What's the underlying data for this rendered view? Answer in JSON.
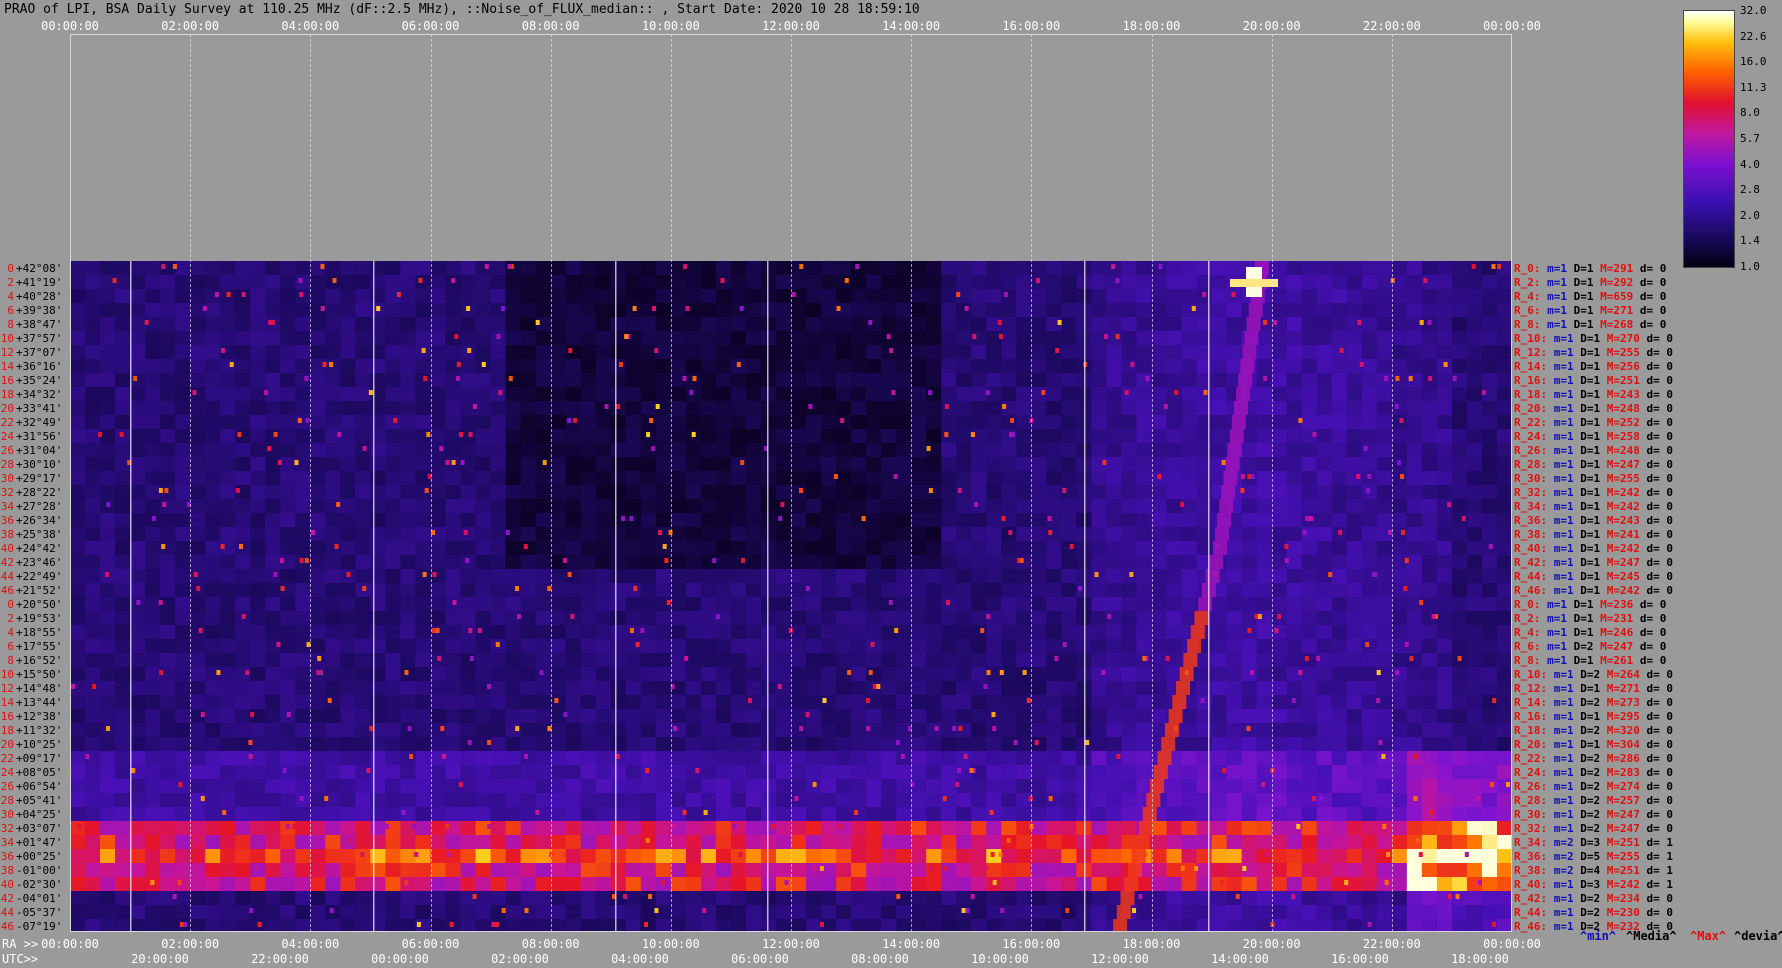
{
  "title": "PRAO of LPI, BSA Daily Survey at 110.25 MHz (dF::2.5 MHz), ::Noise_of_FLUX_median:: , Start Date: 2020 10 28 18:59:10",
  "top_axis_labels": [
    "00:00:00",
    "02:00:00",
    "04:00:00",
    "06:00:00",
    "08:00:00",
    "10:00:00",
    "12:00:00",
    "14:00:00",
    "16:00:00",
    "18:00:00",
    "20:00:00",
    "22:00:00",
    "00:00:00"
  ],
  "ra_axis": {
    "prefix": "RA >>",
    "labels": [
      "00:00:00",
      "02:00:00",
      "04:00:00",
      "06:00:00",
      "08:00:00",
      "10:00:00",
      "12:00:00",
      "14:00:00",
      "16:00:00",
      "18:00:00",
      "20:00:00",
      "22:00:00",
      "00:00:00"
    ]
  },
  "utc_axis": {
    "prefix": "UTC>>",
    "labels": [
      "20:00:00",
      "22:00:00",
      "00:00:00",
      "02:00:00",
      "04:00:00",
      "06:00:00",
      "08:00:00",
      "10:00:00",
      "12:00:00",
      "14:00:00",
      "16:00:00",
      "18:00:00"
    ]
  },
  "colorbar": {
    "ticks": [
      "32.0",
      "22.6",
      "16.0",
      "11.3",
      "8.0",
      "5.7",
      "4.0",
      "2.8",
      "2.0",
      "1.4",
      "1.0"
    ]
  },
  "beam_rows": [
    {
      "idx": "0",
      "dec": "+42°08'",
      "r": "R_0:",
      "m": "m=1",
      "d": "D=1",
      "mx": "M=291",
      "dd": "d= 0"
    },
    {
      "idx": "2",
      "dec": "+41°19'",
      "r": "R_2:",
      "m": "m=1",
      "d": "D=1",
      "mx": "M=292",
      "dd": "d= 0"
    },
    {
      "idx": "4",
      "dec": "+40°28'",
      "r": "R_4:",
      "m": "m=1",
      "d": "D=1",
      "mx": "M=659",
      "dd": "d= 0"
    },
    {
      "idx": "6",
      "dec": "+39°38'",
      "r": "R_6:",
      "m": "m=1",
      "d": "D=1",
      "mx": "M=271",
      "dd": "d= 0"
    },
    {
      "idx": "8",
      "dec": "+38°47'",
      "r": "R_8:",
      "m": "m=1",
      "d": "D=1",
      "mx": "M=268",
      "dd": "d= 0"
    },
    {
      "idx": "10",
      "dec": "+37°57'",
      "r": "R_10:",
      "m": "m=1",
      "d": "D=1",
      "mx": "M=270",
      "dd": "d= 0"
    },
    {
      "idx": "12",
      "dec": "+37°07'",
      "r": "R_12:",
      "m": "m=1",
      "d": "D=1",
      "mx": "M=255",
      "dd": "d= 0"
    },
    {
      "idx": "14",
      "dec": "+36°16'",
      "r": "R_14:",
      "m": "m=1",
      "d": "D=1",
      "mx": "M=256",
      "dd": "d= 0"
    },
    {
      "idx": "16",
      "dec": "+35°24'",
      "r": "R_16:",
      "m": "m=1",
      "d": "D=1",
      "mx": "M=251",
      "dd": "d= 0"
    },
    {
      "idx": "18",
      "dec": "+34°32'",
      "r": "R_18:",
      "m": "m=1",
      "d": "D=1",
      "mx": "M=243",
      "dd": "d= 0"
    },
    {
      "idx": "20",
      "dec": "+33°41'",
      "r": "R_20:",
      "m": "m=1",
      "d": "D=1",
      "mx": "M=248",
      "dd": "d= 0"
    },
    {
      "idx": "22",
      "dec": "+32°49'",
      "r": "R_22:",
      "m": "m=1",
      "d": "D=1",
      "mx": "M=252",
      "dd": "d= 0"
    },
    {
      "idx": "24",
      "dec": "+31°56'",
      "r": "R_24:",
      "m": "m=1",
      "d": "D=1",
      "mx": "M=258",
      "dd": "d= 0"
    },
    {
      "idx": "26",
      "dec": "+31°04'",
      "r": "R_26:",
      "m": "m=1",
      "d": "D=1",
      "mx": "M=248",
      "dd": "d= 0"
    },
    {
      "idx": "28",
      "dec": "+30°10'",
      "r": "R_28:",
      "m": "m=1",
      "d": "D=1",
      "mx": "M=247",
      "dd": "d= 0"
    },
    {
      "idx": "30",
      "dec": "+29°17'",
      "r": "R_30:",
      "m": "m=1",
      "d": "D=1",
      "mx": "M=255",
      "dd": "d= 0"
    },
    {
      "idx": "32",
      "dec": "+28°22'",
      "r": "R_32:",
      "m": "m=1",
      "d": "D=1",
      "mx": "M=242",
      "dd": "d= 0"
    },
    {
      "idx": "34",
      "dec": "+27°28'",
      "r": "R_34:",
      "m": "m=1",
      "d": "D=1",
      "mx": "M=242",
      "dd": "d= 0"
    },
    {
      "idx": "36",
      "dec": "+26°34'",
      "r": "R_36:",
      "m": "m=1",
      "d": "D=1",
      "mx": "M=243",
      "dd": "d= 0"
    },
    {
      "idx": "38",
      "dec": "+25°38'",
      "r": "R_38:",
      "m": "m=1",
      "d": "D=1",
      "mx": "M=241",
      "dd": "d= 0"
    },
    {
      "idx": "40",
      "dec": "+24°42'",
      "r": "R_40:",
      "m": "m=1",
      "d": "D=1",
      "mx": "M=242",
      "dd": "d= 0"
    },
    {
      "idx": "42",
      "dec": "+23°46'",
      "r": "R_42:",
      "m": "m=1",
      "d": "D=1",
      "mx": "M=247",
      "dd": "d= 0"
    },
    {
      "idx": "44",
      "dec": "+22°49'",
      "r": "R_44:",
      "m": "m=1",
      "d": "D=1",
      "mx": "M=245",
      "dd": "d= 0"
    },
    {
      "idx": "46",
      "dec": "+21°52'",
      "r": "R_46:",
      "m": "m=1",
      "d": "D=1",
      "mx": "M=242",
      "dd": "d= 0"
    },
    {
      "idx": "0",
      "dec": "+20°50'",
      "r": "R_0:",
      "m": "m=1",
      "d": "D=1",
      "mx": "M=236",
      "dd": "d= 0"
    },
    {
      "idx": "2",
      "dec": "+19°53'",
      "r": "R_2:",
      "m": "m=1",
      "d": "D=1",
      "mx": "M=231",
      "dd": "d= 0"
    },
    {
      "idx": "4",
      "dec": "+18°55'",
      "r": "R_4:",
      "m": "m=1",
      "d": "D=1",
      "mx": "M=246",
      "dd": "d= 0"
    },
    {
      "idx": "6",
      "dec": "+17°55'",
      "r": "R_6:",
      "m": "m=1",
      "d": "D=2",
      "mx": "M=247",
      "dd": "d= 0"
    },
    {
      "idx": "8",
      "dec": "+16°52'",
      "r": "R_8:",
      "m": "m=1",
      "d": "D=1",
      "mx": "M=261",
      "dd": "d= 0"
    },
    {
      "idx": "10",
      "dec": "+15°50'",
      "r": "R_10:",
      "m": "m=1",
      "d": "D=2",
      "mx": "M=264",
      "dd": "d= 0"
    },
    {
      "idx": "12",
      "dec": "+14°48'",
      "r": "R_12:",
      "m": "m=1",
      "d": "D=1",
      "mx": "M=271",
      "dd": "d= 0"
    },
    {
      "idx": "14",
      "dec": "+13°44'",
      "r": "R_14:",
      "m": "m=1",
      "d": "D=2",
      "mx": "M=273",
      "dd": "d= 0"
    },
    {
      "idx": "16",
      "dec": "+12°38'",
      "r": "R_16:",
      "m": "m=1",
      "d": "D=1",
      "mx": "M=295",
      "dd": "d= 0"
    },
    {
      "idx": "18",
      "dec": "+11°32'",
      "r": "R_18:",
      "m": "m=1",
      "d": "D=2",
      "mx": "M=320",
      "dd": "d= 0"
    },
    {
      "idx": "20",
      "dec": "+10°25'",
      "r": "R_20:",
      "m": "m=1",
      "d": "D=1",
      "mx": "M=304",
      "dd": "d= 0"
    },
    {
      "idx": "22",
      "dec": "+09°17'",
      "r": "R_22:",
      "m": "m=1",
      "d": "D=2",
      "mx": "M=286",
      "dd": "d= 0"
    },
    {
      "idx": "24",
      "dec": "+08°05'",
      "r": "R_24:",
      "m": "m=1",
      "d": "D=2",
      "mx": "M=283",
      "dd": "d= 0"
    },
    {
      "idx": "26",
      "dec": "+06°54'",
      "r": "R_26:",
      "m": "m=1",
      "d": "D=2",
      "mx": "M=274",
      "dd": "d= 0"
    },
    {
      "idx": "28",
      "dec": "+05°41'",
      "r": "R_28:",
      "m": "m=1",
      "d": "D=2",
      "mx": "M=257",
      "dd": "d= 0"
    },
    {
      "idx": "30",
      "dec": "+04°25'",
      "r": "R_30:",
      "m": "m=1",
      "d": "D=2",
      "mx": "M=247",
      "dd": "d= 0"
    },
    {
      "idx": "32",
      "dec": "+03°07'",
      "r": "R_32:",
      "m": "m=1",
      "d": "D=2",
      "mx": "M=247",
      "dd": "d= 0"
    },
    {
      "idx": "34",
      "dec": "+01°47'",
      "r": "R_34:",
      "m": "m=2",
      "d": "D=3",
      "mx": "M=251",
      "dd": "d= 1"
    },
    {
      "idx": "36",
      "dec": "+00°25'",
      "r": "R_36:",
      "m": "m=2",
      "d": "D=5",
      "mx": "M=255",
      "dd": "d= 1"
    },
    {
      "idx": "38",
      "dec": "-01°00'",
      "r": "R_38:",
      "m": "m=2",
      "d": "D=4",
      "mx": "M=251",
      "dd": "d= 1"
    },
    {
      "idx": "40",
      "dec": "-02°30'",
      "r": "R_40:",
      "m": "m=1",
      "d": "D=3",
      "mx": "M=242",
      "dd": "d= 1"
    },
    {
      "idx": "42",
      "dec": "-04°01'",
      "r": "R_42:",
      "m": "m=1",
      "d": "D=2",
      "mx": "M=234",
      "dd": "d= 0"
    },
    {
      "idx": "44",
      "dec": "-05°37'",
      "r": "R_44:",
      "m": "m=1",
      "d": "D=2",
      "mx": "M=230",
      "dd": "d= 0"
    },
    {
      "idx": "46",
      "dec": "-07°19'",
      "r": "R_46:",
      "m": "m=1",
      "d": "D=2",
      "mx": "M=232",
      "dd": "d= 0"
    }
  ],
  "legend": {
    "min": "^min^",
    "media": "^Media^",
    "max": "^Max^",
    "devia": "^devia^"
  },
  "colors": {
    "background": "#9a9a9a",
    "min": "#1010b0",
    "max": "#e01010"
  }
}
